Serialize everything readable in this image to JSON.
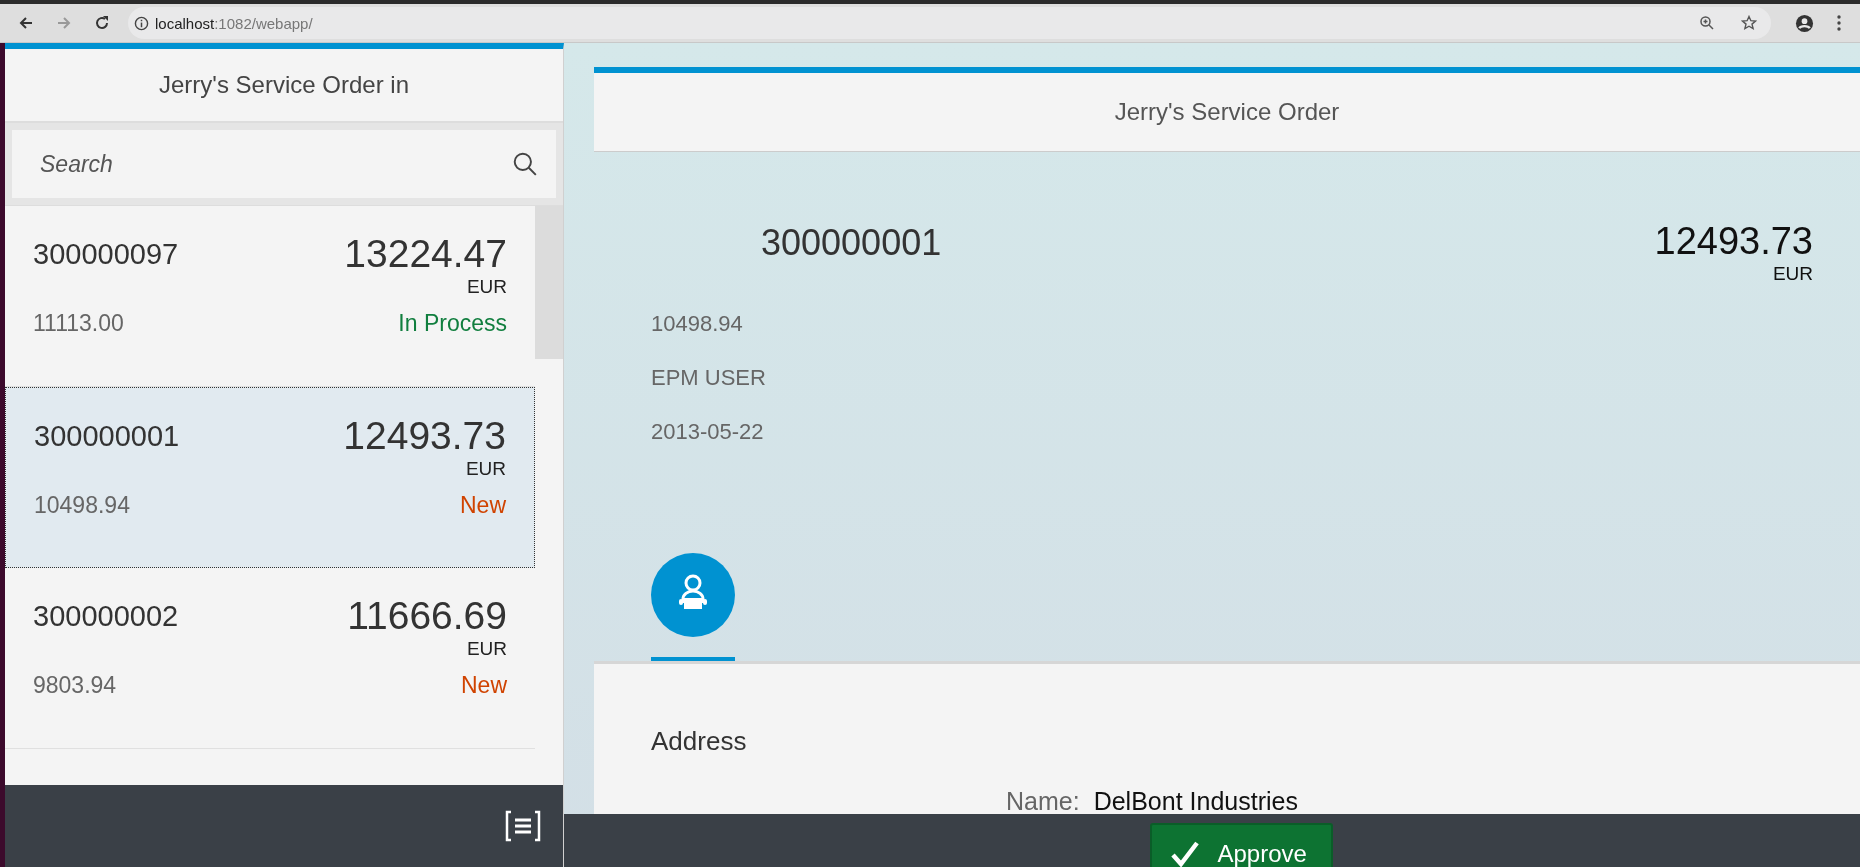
{
  "browser": {
    "url_host": "localhost",
    "url_path": ":1082/webapp/"
  },
  "master": {
    "title": "Jerry's Service Order in",
    "search": {
      "placeholder": "Search"
    },
    "items": [
      {
        "number": "300000097",
        "amount": "13224.47",
        "currency": "EUR",
        "net": "11113.00",
        "status": "In Process",
        "color": "#107e3e",
        "selected": false
      },
      {
        "number": "300000001",
        "amount": "12493.73",
        "currency": "EUR",
        "net": "10498.94",
        "status": "New",
        "color": "#d04300",
        "selected": true
      },
      {
        "number": "300000002",
        "amount": "11666.69",
        "currency": "EUR",
        "net": "9803.94",
        "status": "New",
        "color": "#d04300",
        "selected": false
      }
    ]
  },
  "detail": {
    "title": "Jerry's Service Order",
    "object": {
      "number": "300000001",
      "amount": "12493.73",
      "currency": "EUR",
      "attributes": [
        "10498.94",
        "EPM USER",
        "2013-05-22"
      ]
    },
    "tabs": [
      {
        "selected": true
      }
    ],
    "section": {
      "title": "Address",
      "fields": [
        {
          "label": "Name:",
          "value": "DelBont Industries"
        }
      ]
    },
    "footer": {
      "buttons": [
        "Approve"
      ]
    }
  }
}
